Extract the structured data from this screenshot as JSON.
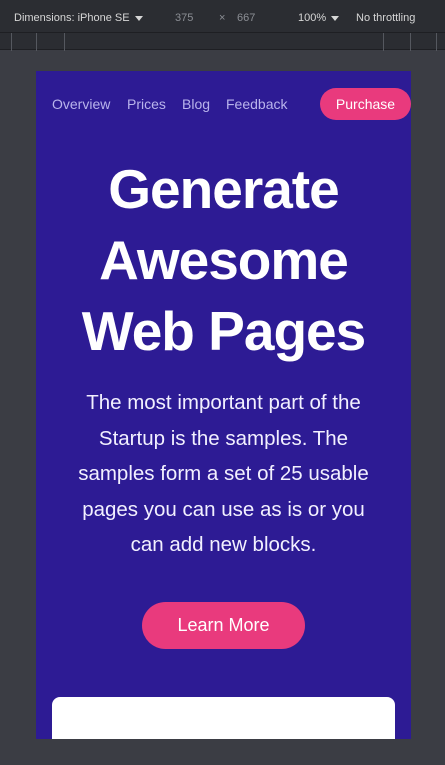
{
  "devtools": {
    "dimensions_label": "Dimensions: iPhone SE",
    "width": "375",
    "times": "×",
    "height": "667",
    "zoom": "100%",
    "throttling": "No throttling"
  },
  "page": {
    "nav": [
      "Overview",
      "Prices",
      "Blog",
      "Feedback"
    ],
    "purchase_label": "Purchase",
    "hero_title_lines": [
      "Generate",
      "Awesome",
      "Web Pages"
    ],
    "hero_text_lines": [
      "The most important part of the",
      "Startup is the samples. The",
      "samples form a set of 25 usable",
      "pages you can use as is or you",
      "can add new blocks."
    ],
    "learn_more_label": "Learn More"
  },
  "colors": {
    "hero_bg": "#2d1b94",
    "accent": "#e93a7d",
    "devtools_bg": "#2b2d32",
    "canvas_bg": "#3b3d44"
  }
}
